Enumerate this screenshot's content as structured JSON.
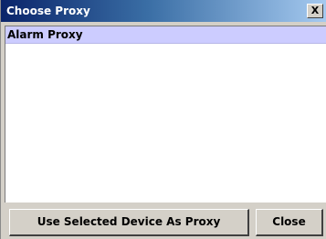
{
  "window": {
    "title": "Choose Proxy",
    "close_glyph": "X"
  },
  "list": {
    "items": [
      {
        "label": "Alarm Proxy",
        "selected": true
      }
    ]
  },
  "buttons": {
    "use_selected_label": "Use Selected Device As Proxy",
    "close_label": "Close"
  },
  "colors": {
    "title_bar": "#0a246a",
    "selection": "#ccccff",
    "button_face": "#d4d0c8"
  }
}
